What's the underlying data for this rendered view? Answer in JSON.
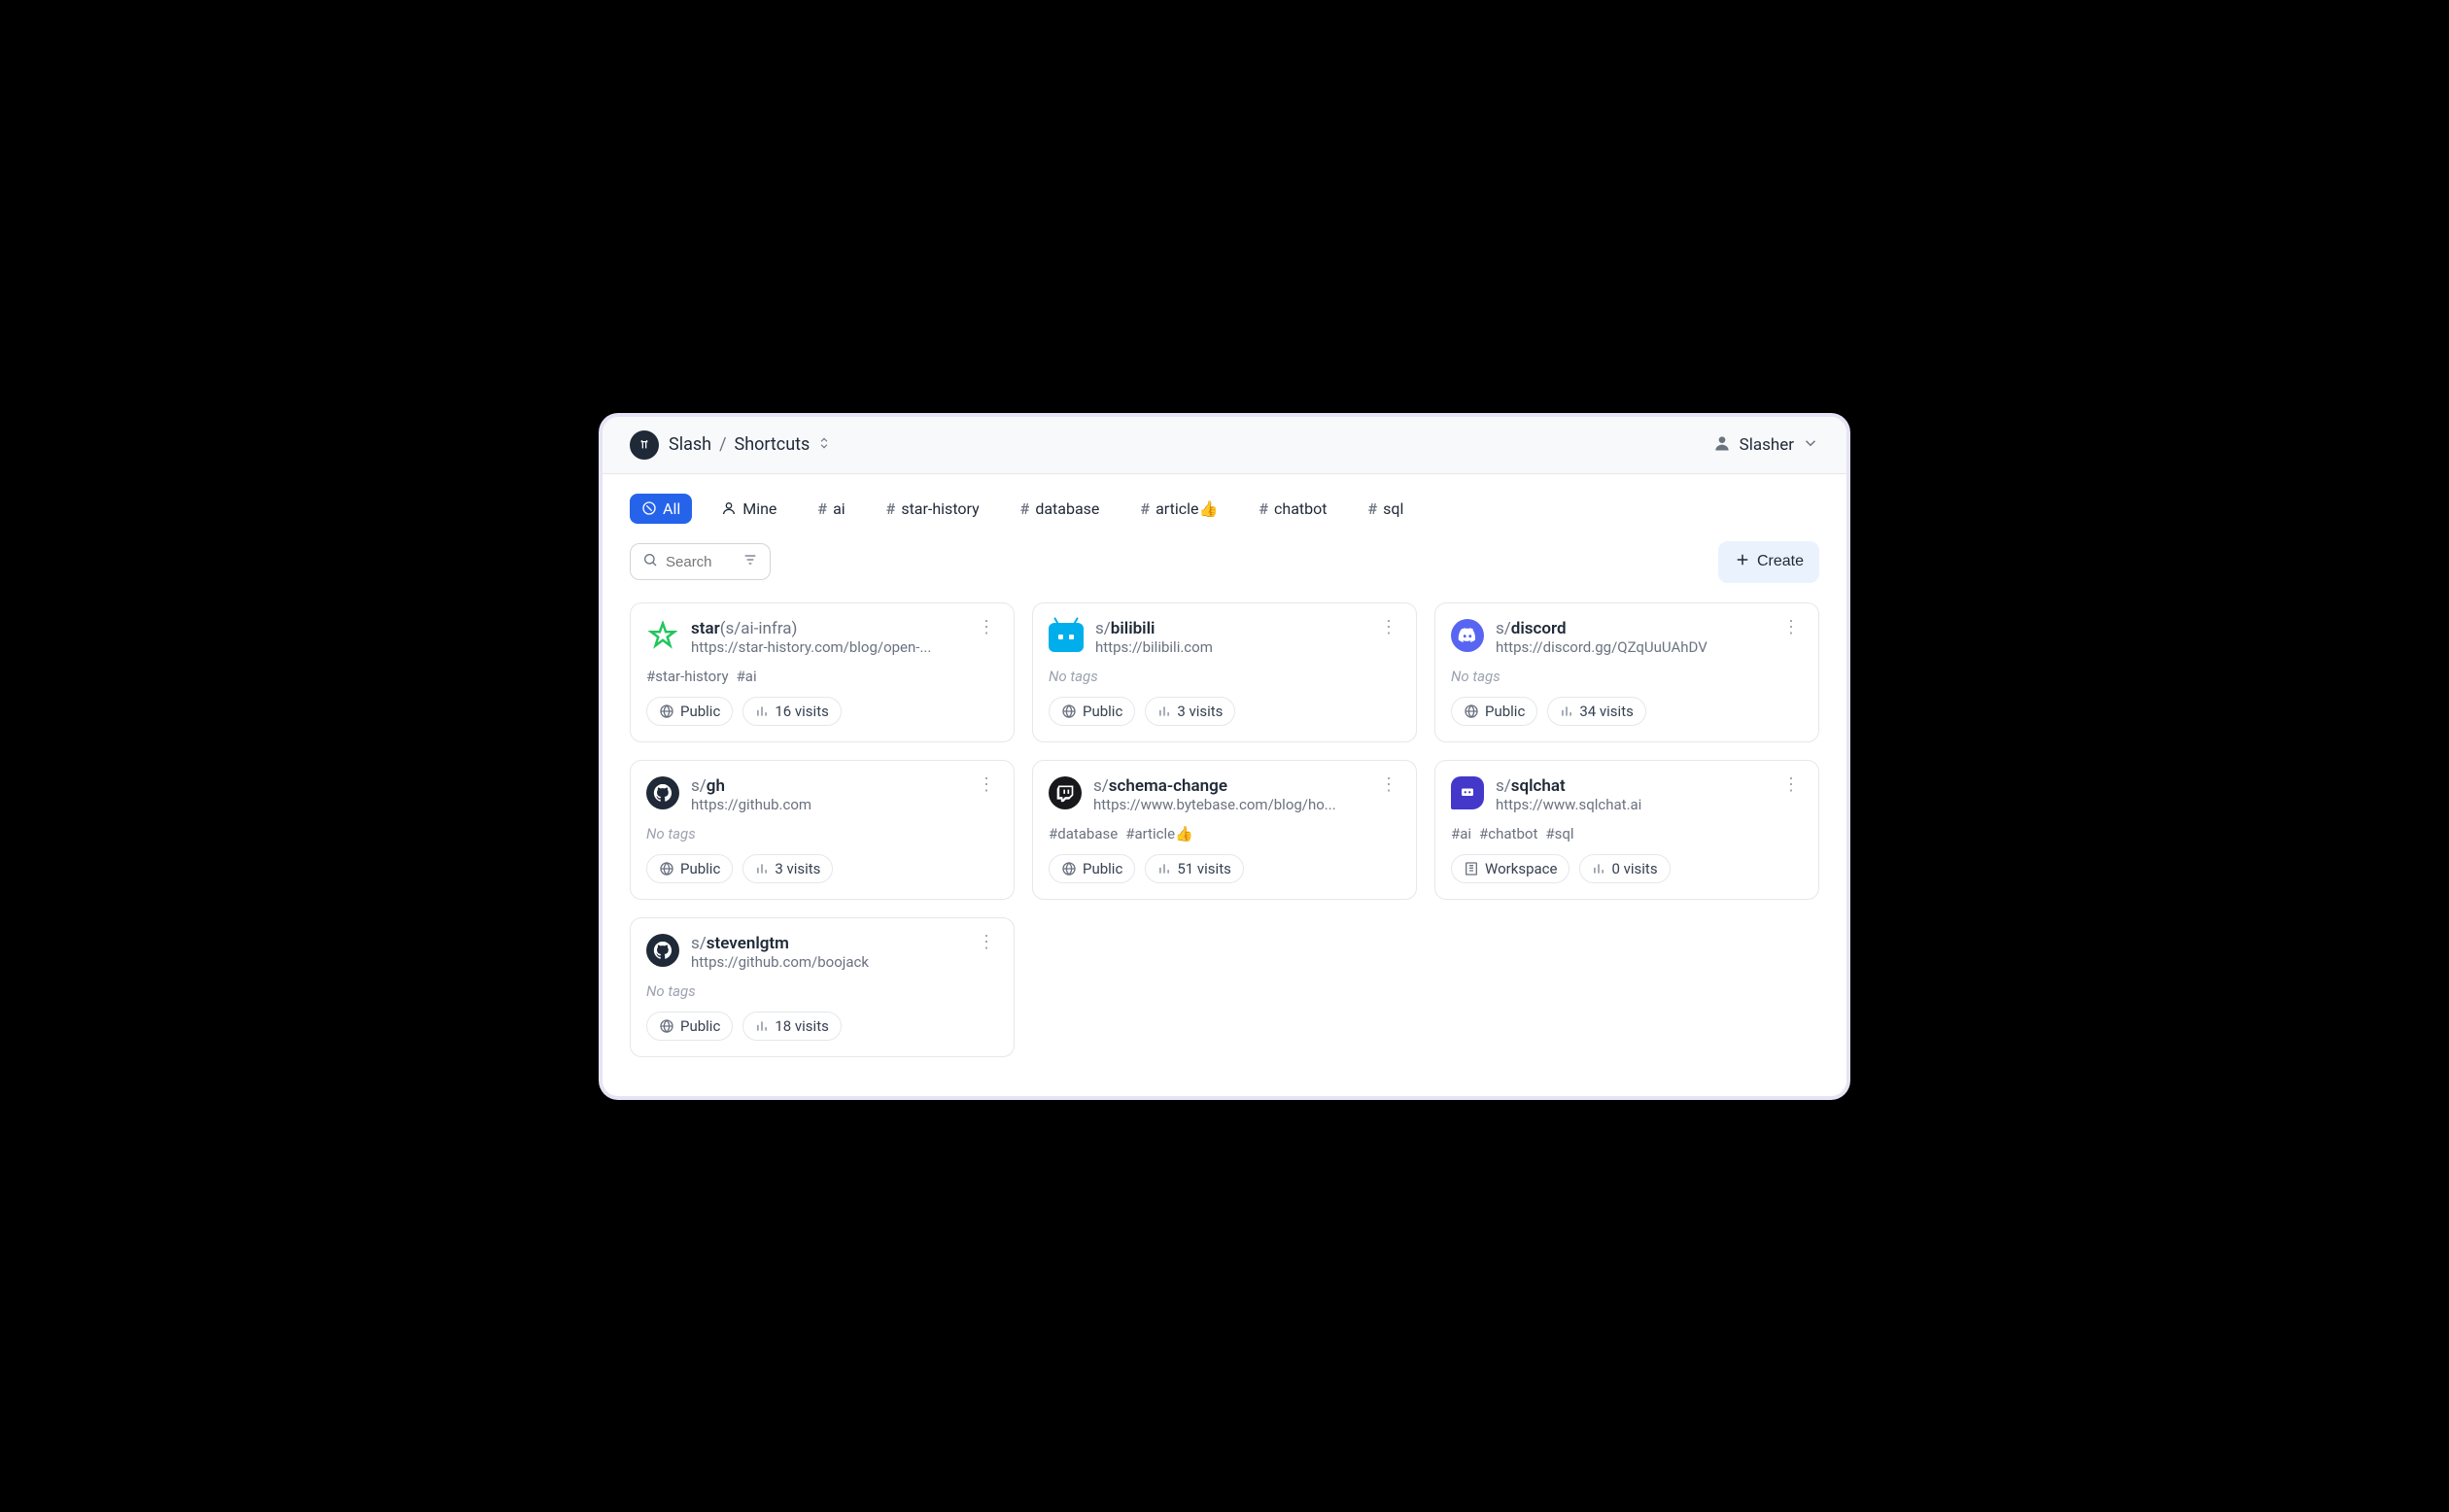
{
  "header": {
    "app_name": "Slash",
    "page_name": "Shortcuts",
    "user_name": "Slasher"
  },
  "filters": [
    {
      "type": "all",
      "label": "All"
    },
    {
      "type": "mine",
      "label": "Mine"
    },
    {
      "type": "tag",
      "label": "ai"
    },
    {
      "type": "tag",
      "label": "star-history"
    },
    {
      "type": "tag",
      "label": "database"
    },
    {
      "type": "tag",
      "label": "article👍"
    },
    {
      "type": "tag",
      "label": "chatbot"
    },
    {
      "type": "tag",
      "label": "sql"
    }
  ],
  "search": {
    "placeholder": "Search"
  },
  "create_label": "Create",
  "no_tags_label": "No tags",
  "cards": [
    {
      "icon": "star",
      "prefix": "star",
      "name": "",
      "suffix": "(s/ai-infra)",
      "url": "https://star-history.com/blog/open-...",
      "tags": [
        "star-history",
        "ai"
      ],
      "visibility": "Public",
      "visits": "16 visits"
    },
    {
      "icon": "bilibili",
      "prefix": "s/",
      "name": "bilibili",
      "suffix": "",
      "url": "https://bilibili.com",
      "tags": [],
      "visibility": "Public",
      "visits": "3 visits"
    },
    {
      "icon": "discord",
      "prefix": "s/",
      "name": "discord",
      "suffix": "",
      "url": "https://discord.gg/QZqUuUAhDV",
      "tags": [],
      "visibility": "Public",
      "visits": "34 visits"
    },
    {
      "icon": "github",
      "prefix": "s/",
      "name": "gh",
      "suffix": "",
      "url": "https://github.com",
      "tags": [],
      "visibility": "Public",
      "visits": "3 visits"
    },
    {
      "icon": "twitch",
      "prefix": "s/",
      "name": "schema-change",
      "suffix": "",
      "url": "https://www.bytebase.com/blog/ho...",
      "tags": [
        "database",
        "article👍"
      ],
      "visibility": "Public",
      "visits": "51 visits"
    },
    {
      "icon": "sqlchat",
      "prefix": "s/",
      "name": "sqlchat",
      "suffix": "",
      "url": "https://www.sqlchat.ai",
      "tags": [
        "ai",
        "chatbot",
        "sql"
      ],
      "visibility": "Workspace",
      "visits": "0 visits"
    },
    {
      "icon": "github",
      "prefix": "s/",
      "name": "stevenlgtm",
      "suffix": "",
      "url": "https://github.com/boojack",
      "tags": [],
      "visibility": "Public",
      "visits": "18 visits"
    }
  ]
}
